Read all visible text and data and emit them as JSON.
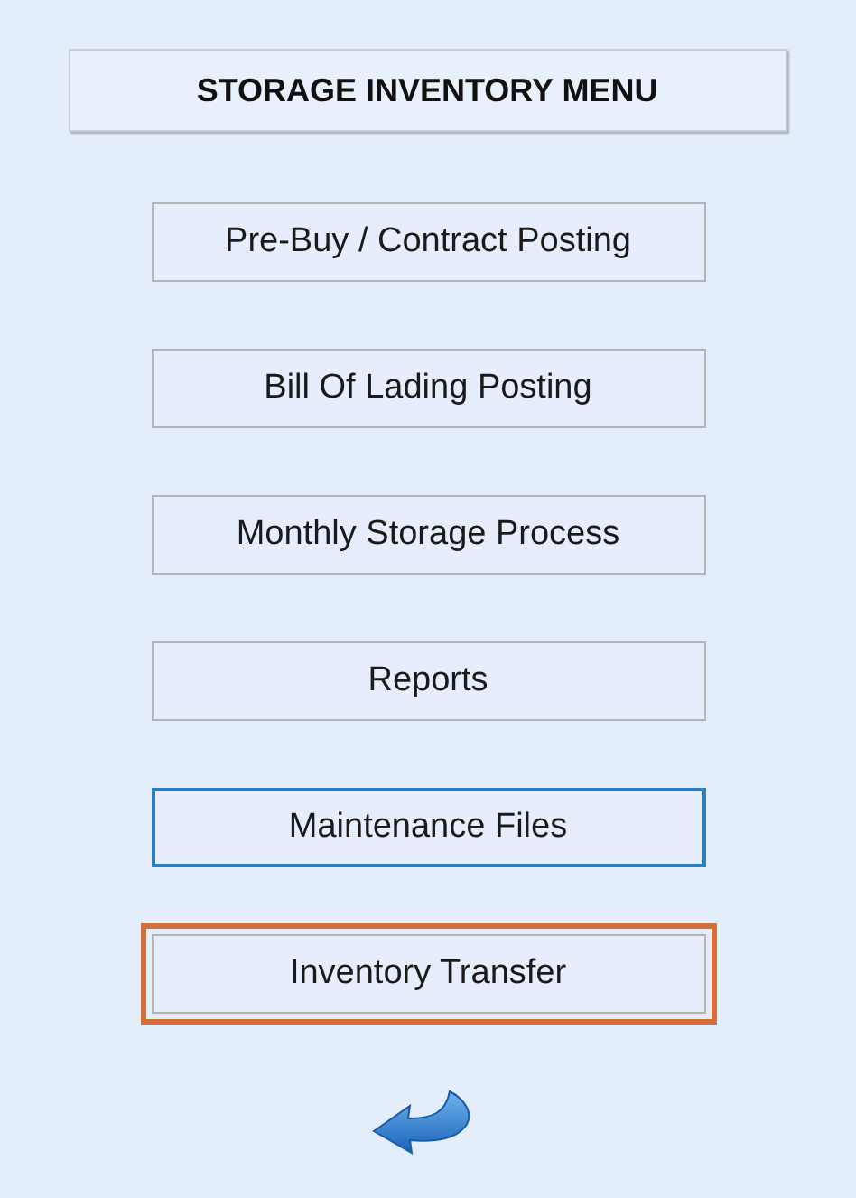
{
  "title": "STORAGE INVENTORY MENU",
  "buttons": [
    {
      "label": "Pre-Buy / Contract Posting",
      "hovered": false,
      "focused": false
    },
    {
      "label": "Bill Of Lading Posting",
      "hovered": false,
      "focused": false
    },
    {
      "label": "Monthly Storage Process",
      "hovered": false,
      "focused": false
    },
    {
      "label": "Reports",
      "hovered": false,
      "focused": false
    },
    {
      "label": "Maintenance Files",
      "hovered": true,
      "focused": false
    },
    {
      "label": "Inventory Transfer",
      "hovered": false,
      "focused": true
    }
  ]
}
